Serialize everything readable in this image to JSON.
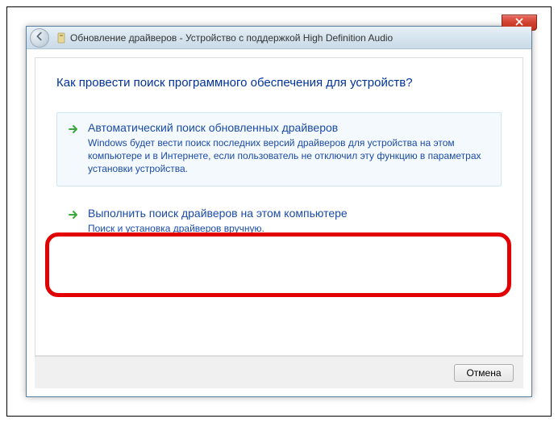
{
  "window": {
    "title": "Обновление драйверов - Устройство с поддержкой High Definition Audio"
  },
  "heading": "Как провести поиск программного обеспечения для устройств?",
  "options": {
    "auto": {
      "title": "Автоматический поиск обновленных драйверов",
      "desc": "Windows будет вести поиск последних версий драйверов для устройства на этом компьютере и в Интернете, если пользователь не отключил эту функцию в параметрах установки устройства."
    },
    "manual": {
      "title": "Выполнить поиск драйверов на этом компьютере",
      "desc": "Поиск и установка драйверов вручную."
    }
  },
  "footer": {
    "cancel": "Отмена"
  }
}
